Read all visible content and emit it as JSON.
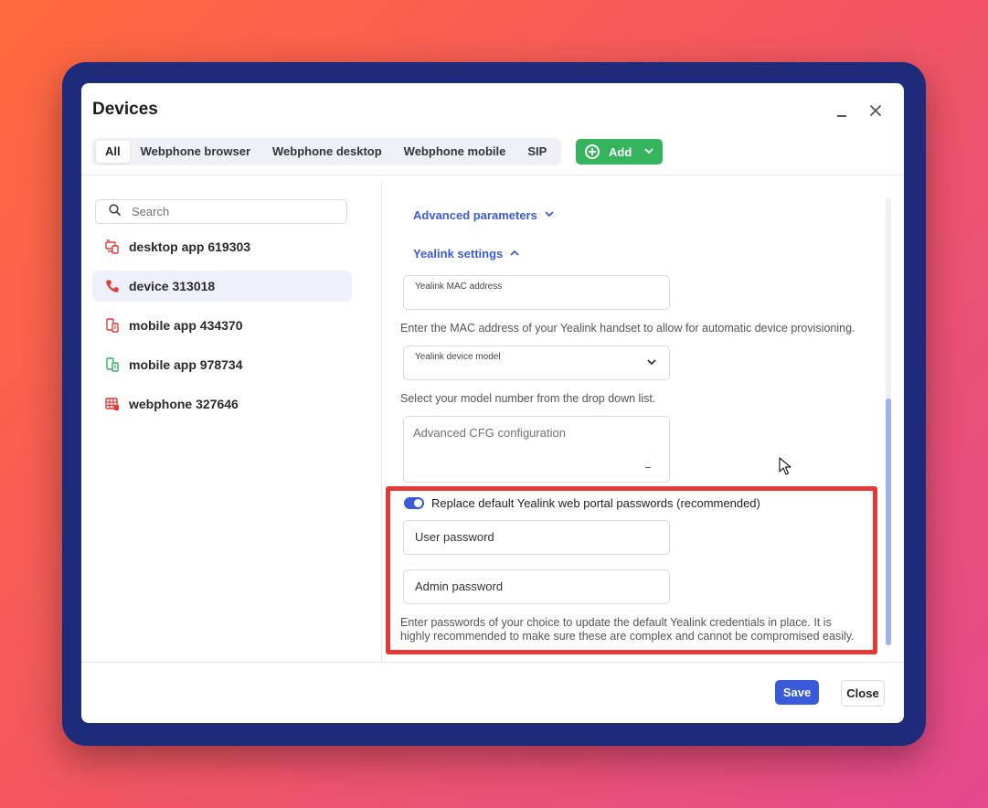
{
  "window": {
    "title": "Devices",
    "minimize_icon": "minimize-icon",
    "close_icon": "close-icon"
  },
  "tabs": [
    {
      "label": "All",
      "active": true
    },
    {
      "label": "Webphone browser",
      "active": false
    },
    {
      "label": "Webphone desktop",
      "active": false
    },
    {
      "label": "Webphone mobile",
      "active": false
    },
    {
      "label": "SIP",
      "active": false
    }
  ],
  "add_button": {
    "label": "Add",
    "icon": "plus-circle-icon",
    "color": "#35b35d"
  },
  "search": {
    "placeholder": "Search"
  },
  "devices": [
    {
      "label": "desktop app 619303",
      "icon": "desktop-app-icon",
      "color": "#e53935",
      "selected": false
    },
    {
      "label": "device 313018",
      "icon": "phone-icon",
      "color": "#e53935",
      "selected": true
    },
    {
      "label": "mobile app 434370",
      "icon": "mobile-app-icon",
      "color": "#e53935",
      "selected": false
    },
    {
      "label": "mobile app 978734",
      "icon": "mobile-app-icon",
      "color": "#35b35d",
      "selected": false
    },
    {
      "label": "webphone 327646",
      "icon": "webphone-icon",
      "color": "#e53935",
      "selected": false
    }
  ],
  "settings": {
    "advanced_parameters_label": "Advanced parameters",
    "yealink_settings_label": "Yealink settings",
    "mac_field_label": "Yealink MAC address",
    "mac_helper": "Enter the MAC address of your Yealink handset to allow for automatic device provisioning.",
    "model_field_label": "Yealink device model",
    "model_helper": "Select your model number from the drop down list.",
    "cfg_placeholder": "Advanced CFG configuration",
    "replace_toggle_label": "Replace default Yealink web portal passwords (recommended)",
    "replace_toggle_on": true,
    "user_password_label": "User password",
    "admin_password_label": "Admin password",
    "password_helper_line1": "Enter passwords of your choice to update the default Yealink credentials in place. It is",
    "password_helper_line2": "highly recommended to make sure these are complex and cannot be compromised easily."
  },
  "footer": {
    "save_label": "Save",
    "close_label": "Close"
  },
  "colors": {
    "accent": "#3a5bd9",
    "highlight": "#e53935",
    "frame": "#1e2b7a"
  }
}
